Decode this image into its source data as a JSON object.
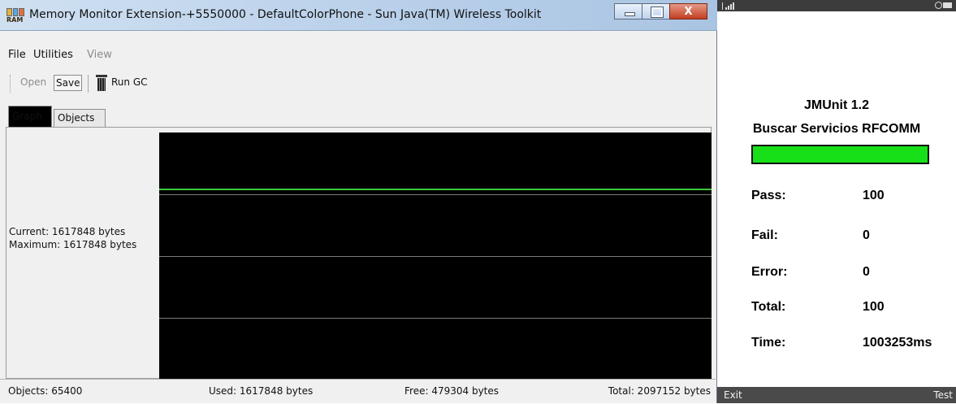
{
  "window": {
    "title": "Memory Monitor Extension-+5550000 - DefaultColorPhone - Sun Java(TM) Wireless Toolkit",
    "icon_text": "RAM",
    "close_glyph": "X"
  },
  "menu": {
    "file": "File",
    "utilities": "Utilities",
    "view": "View"
  },
  "toolbar": {
    "open": "Open",
    "save": "Save",
    "run_gc": "Run GC"
  },
  "tabs": {
    "graph": "Graph",
    "objects": "Objects"
  },
  "graph_panel": {
    "current": "Current: 1617848 bytes",
    "maximum": "Maximum: 1617848 bytes",
    "used_fraction_of_total": 0.7714,
    "line_color": "#3ec63e",
    "background": "#000000"
  },
  "status": {
    "objects": "Objects: 65400",
    "used": "Used: 1617848 bytes",
    "free": "Free: 479304 bytes",
    "total": "Total: 2097152 bytes"
  },
  "phone": {
    "title": "JMUnit 1.2",
    "subtitle": "Buscar Servicios RFCOMM",
    "progress": 1.0,
    "progress_color": "#18e018",
    "stats": [
      {
        "label": "Pass:",
        "value": "100"
      },
      {
        "label": "Fail:",
        "value": "0"
      },
      {
        "label": "Error:",
        "value": "0"
      },
      {
        "label": "Total:",
        "value": "100"
      },
      {
        "label": "Time:",
        "value": "1003253ms"
      }
    ],
    "soft_left": "Exit",
    "soft_right": "Test"
  }
}
